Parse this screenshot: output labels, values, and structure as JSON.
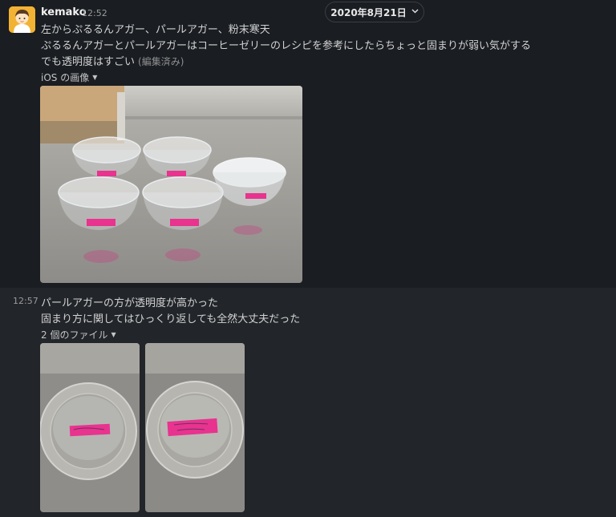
{
  "date_divider": {
    "label": "2020年8月21日",
    "chevron_icon": "chevron-down-icon"
  },
  "message1": {
    "user": "kemako",
    "time": "12:52",
    "lines": [
      "左からぷるるんアガー、パールアガー、粉末寒天",
      "ぷるるんアガーとパールアガーはコーヒーゼリーのレシピを参考にしたらちょっと固まりが弱い気がする",
      "でも透明度はすごい"
    ],
    "edited_label": "(編集済み)",
    "attachment_toggle": "iOS の画像"
  },
  "message2": {
    "time": "12:57",
    "lines": [
      "パールアガーの方が透明度が高かった",
      "固まり方に関してはひっくり返しても全然大丈夫だった"
    ],
    "attachment_toggle": "2 個のファイル"
  },
  "colors": {
    "background": "#1a1d21",
    "hover_row": "#222529",
    "label_pink": "#e8338f"
  }
}
